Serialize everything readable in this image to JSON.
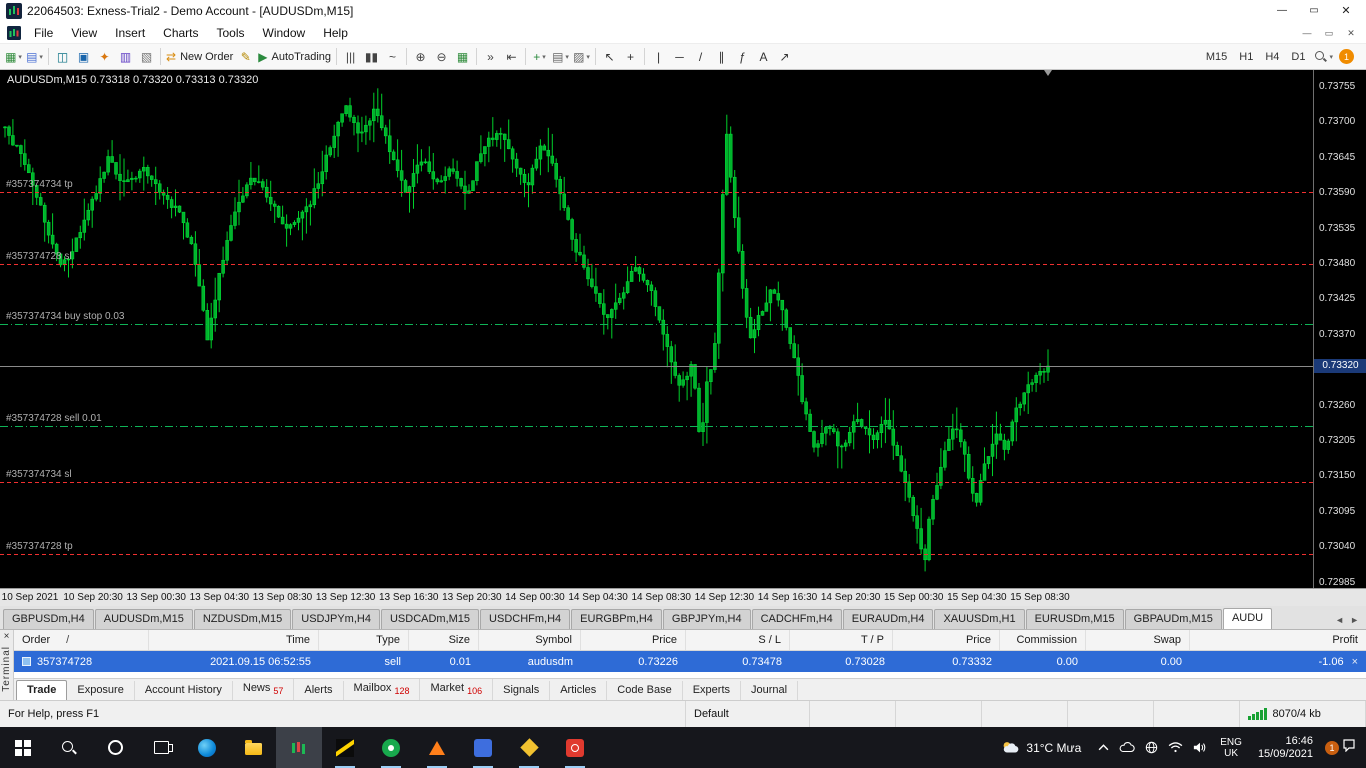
{
  "window": {
    "title": "22064503: Exness-Trial2 - Demo Account - [AUDUSDm,M15]",
    "controls": {
      "minimize": "—",
      "restore": "▭",
      "close": "✕"
    }
  },
  "menu": {
    "items": [
      "File",
      "View",
      "Insert",
      "Charts",
      "Tools",
      "Window",
      "Help"
    ]
  },
  "toolbar": {
    "caret_glyph": "▾",
    "notification_count": "1",
    "timeframes": [
      "M15",
      "H1",
      "H4",
      "D1"
    ],
    "groups": [
      {
        "items": [
          {
            "name": "new-chart",
            "glyph": "▦",
            "color": "#2e8b3a",
            "caret": true
          },
          {
            "name": "profiles",
            "glyph": "▤",
            "color": "#4a6fd4",
            "caret": true
          }
        ]
      },
      {
        "items": [
          {
            "name": "market-watch",
            "glyph": "◫",
            "color": "#0b7285"
          },
          {
            "name": "data-window",
            "glyph": "▣",
            "color": "#1864ab"
          },
          {
            "name": "navigator",
            "glyph": "✦",
            "color": "#d9770f"
          },
          {
            "name": "terminal-panel",
            "glyph": "▥",
            "color": "#5f3dc4"
          },
          {
            "name": "strategy-tester",
            "glyph": "▧",
            "color": "#767676"
          }
        ]
      },
      {
        "items": [
          {
            "name": "new-order",
            "glyph": "⇄",
            "color": "#d98b0f",
            "label": "New Order"
          },
          {
            "name": "metaeditor",
            "glyph": "✎",
            "color": "#b58900"
          },
          {
            "name": "autotrading",
            "glyph": "▶",
            "color": "#2b8a3e",
            "label": "AutoTrading"
          }
        ]
      },
      {
        "items": [
          {
            "name": "bar-chart-mode",
            "glyph": "|||",
            "color": "#444444"
          },
          {
            "name": "candlestick-mode",
            "glyph": "▮▮",
            "color": "#444444"
          },
          {
            "name": "line-chart-mode",
            "glyph": "~",
            "color": "#444444"
          }
        ]
      },
      {
        "items": [
          {
            "name": "zoom-in",
            "glyph": "⊕",
            "color": "#444444"
          },
          {
            "name": "zoom-out",
            "glyph": "⊖",
            "color": "#444444"
          },
          {
            "name": "tile-windows",
            "glyph": "▦",
            "color": "#2e8b3a"
          }
        ]
      },
      {
        "items": [
          {
            "name": "auto-scroll",
            "glyph": "»",
            "color": "#444444"
          },
          {
            "name": "chart-shift",
            "glyph": "⇤",
            "color": "#444444"
          }
        ]
      },
      {
        "items": [
          {
            "name": "indicators",
            "glyph": "+",
            "color": "#2b8a3e",
            "caret": true
          },
          {
            "name": "periods",
            "glyph": "▤",
            "color": "#666666",
            "caret": true
          },
          {
            "name": "templates",
            "glyph": "▨",
            "color": "#666666",
            "caret": true
          }
        ]
      },
      {
        "items": [
          {
            "name": "cursor",
            "glyph": "↖",
            "color": "#333333"
          },
          {
            "name": "crosshair",
            "glyph": "+",
            "color": "#333333"
          }
        ]
      },
      {
        "items": [
          {
            "name": "vertical-line",
            "glyph": "|",
            "color": "#333333"
          },
          {
            "name": "horizontal-line",
            "glyph": "─",
            "color": "#333333"
          },
          {
            "name": "trendline",
            "glyph": "/",
            "color": "#333333"
          },
          {
            "name": "equidistant-channel",
            "glyph": "∥",
            "color": "#333333"
          },
          {
            "name": "fibonacci",
            "glyph": "ƒ",
            "color": "#333333"
          },
          {
            "name": "text-label",
            "glyph": "A",
            "color": "#333333"
          },
          {
            "name": "arrows-tool",
            "glyph": "↗",
            "color": "#333333"
          }
        ]
      }
    ]
  },
  "chart": {
    "symbol_ohlc": "AUDUSDm,M15 0.73318 0.73320 0.73313 0.73320",
    "price_axis": {
      "min": 0.72975,
      "max": 0.7378,
      "labels": [
        "0.73755",
        "0.73700",
        "0.73645",
        "0.73590",
        "0.73535",
        "0.73480",
        "0.73425",
        "0.73370",
        "0.73260",
        "0.73205",
        "0.73150",
        "0.73095",
        "0.73040",
        "0.72985"
      ],
      "current": "0.73320"
    },
    "time_axis": [
      "10 Sep 2021",
      "10 Sep 20:30",
      "13 Sep 00:30",
      "13 Sep 04:30",
      "13 Sep 08:30",
      "13 Sep 12:30",
      "13 Sep 16:30",
      "13 Sep 20:30",
      "14 Sep 00:30",
      "14 Sep 04:30",
      "14 Sep 08:30",
      "14 Sep 12:30",
      "14 Sep 16:30",
      "14 Sep 20:30",
      "15 Sep 00:30",
      "15 Sep 04:30",
      "15 Sep 08:30"
    ],
    "levels": [
      {
        "label": "#357374734 tp",
        "price": 0.7359,
        "color": "#f03030",
        "style": "dashed"
      },
      {
        "label": "#357374728 sl",
        "price": 0.73478,
        "color": "#f03030",
        "style": "dashed"
      },
      {
        "label": "#357374734 buy stop 0.03",
        "price": 0.73386,
        "color": "#0fb357",
        "style": "dashdot"
      },
      {
        "label": "#357374728 sell 0.01",
        "price": 0.73226,
        "color": "#0fb357",
        "style": "dashdot"
      },
      {
        "label": "#357374734 sl",
        "price": 0.7314,
        "color": "#f03030",
        "style": "dashed"
      },
      {
        "label": "#357374728 tp",
        "price": 0.73028,
        "color": "#f03030",
        "style": "dashed"
      }
    ],
    "chart_data": {
      "type": "candlestick",
      "symbol": "AUDUSDm",
      "timeframe": "M15",
      "ohlc_display": {
        "open": "0.73318",
        "high": "0.73320",
        "low": "0.73313",
        "close": "0.73320"
      },
      "last_close": 0.7332,
      "candle_count": 264,
      "price_range": [
        0.72975,
        0.7378
      ],
      "visible_span": "10 Sep 2021 00:00 - 15 Sep 2021 08:30",
      "path_waypoints": [
        [
          5,
          0.7369
        ],
        [
          18,
          0.73655
        ],
        [
          32,
          0.7361
        ],
        [
          48,
          0.7353
        ],
        [
          60,
          0.73472
        ],
        [
          72,
          0.735
        ],
        [
          88,
          0.73555
        ],
        [
          108,
          0.7364
        ],
        [
          125,
          0.736
        ],
        [
          145,
          0.73625
        ],
        [
          165,
          0.7358
        ],
        [
          182,
          0.73555
        ],
        [
          196,
          0.7348
        ],
        [
          207,
          0.7336
        ],
        [
          218,
          0.7345
        ],
        [
          232,
          0.7355
        ],
        [
          252,
          0.73615
        ],
        [
          268,
          0.7358
        ],
        [
          288,
          0.7353
        ],
        [
          308,
          0.73565
        ],
        [
          328,
          0.7365
        ],
        [
          345,
          0.73725
        ],
        [
          360,
          0.7368
        ],
        [
          375,
          0.7372
        ],
        [
          392,
          0.73645
        ],
        [
          407,
          0.7359
        ],
        [
          422,
          0.73645
        ],
        [
          437,
          0.736
        ],
        [
          452,
          0.73625
        ],
        [
          467,
          0.7358
        ],
        [
          482,
          0.7366
        ],
        [
          500,
          0.7369
        ],
        [
          512,
          0.7364
        ],
        [
          528,
          0.736
        ],
        [
          540,
          0.73665
        ],
        [
          552,
          0.7364
        ],
        [
          558,
          0.736
        ],
        [
          574,
          0.7351
        ],
        [
          590,
          0.7345
        ],
        [
          605,
          0.7339
        ],
        [
          620,
          0.73425
        ],
        [
          636,
          0.73475
        ],
        [
          652,
          0.7343
        ],
        [
          666,
          0.7335
        ],
        [
          680,
          0.73285
        ],
        [
          692,
          0.73325
        ],
        [
          701,
          0.73195
        ],
        [
          707,
          0.7329
        ],
        [
          714,
          0.7333
        ],
        [
          720,
          0.735
        ],
        [
          726,
          0.7369
        ],
        [
          733,
          0.7358
        ],
        [
          741,
          0.7346
        ],
        [
          750,
          0.7336
        ],
        [
          760,
          0.734
        ],
        [
          772,
          0.73445
        ],
        [
          783,
          0.734
        ],
        [
          794,
          0.7333
        ],
        [
          804,
          0.73255
        ],
        [
          815,
          0.73185
        ],
        [
          828,
          0.7323
        ],
        [
          842,
          0.7319
        ],
        [
          857,
          0.7324
        ],
        [
          872,
          0.73205
        ],
        [
          886,
          0.7324
        ],
        [
          899,
          0.73165
        ],
        [
          910,
          0.7311
        ],
        [
          921,
          0.7304
        ],
        [
          924,
          0.73005
        ],
        [
          928,
          0.7308
        ],
        [
          943,
          0.73175
        ],
        [
          954,
          0.7323
        ],
        [
          965,
          0.73175
        ],
        [
          975,
          0.731
        ],
        [
          985,
          0.73165
        ],
        [
          995,
          0.73215
        ],
        [
          1005,
          0.73185
        ],
        [
          1015,
          0.73245
        ],
        [
          1026,
          0.73285
        ],
        [
          1037,
          0.73305
        ],
        [
          1048,
          0.7332
        ]
      ]
    }
  },
  "chart_tabs": {
    "scroll_left": "◄",
    "scroll_right": "►",
    "tabs": [
      {
        "label": "GBPUSDm,H4"
      },
      {
        "label": "AUDUSDm,M15"
      },
      {
        "label": "NZDUSDm,M15"
      },
      {
        "label": "USDJPYm,H4"
      },
      {
        "label": "USDCADm,M15"
      },
      {
        "label": "USDCHFm,H4"
      },
      {
        "label": "EURGBPm,H4"
      },
      {
        "label": "GBPJPYm,H4"
      },
      {
        "label": "CADCHFm,H4"
      },
      {
        "label": "EURAUDm,H4"
      },
      {
        "label": "XAUUSDm,H1"
      },
      {
        "label": "EURUSDm,M15"
      },
      {
        "label": "GBPAUDm,M15"
      },
      {
        "label": "AUDU",
        "active": true
      }
    ]
  },
  "terminal": {
    "close_glyph": "×",
    "vertical_label": "Terminal",
    "columns": [
      {
        "label": "Order",
        "sort": "/"
      },
      {
        "label": "Time"
      },
      {
        "label": "Type"
      },
      {
        "label": "Size"
      },
      {
        "label": "Symbol"
      },
      {
        "label": "Price"
      },
      {
        "label": "S / L"
      },
      {
        "label": "T / P"
      },
      {
        "label": "Price"
      },
      {
        "label": "Commission"
      },
      {
        "label": "Swap"
      },
      {
        "label": "Profit"
      }
    ],
    "orders": [
      {
        "order": "357374728",
        "time": "2021.09.15 06:52:55",
        "type": "sell",
        "size": "0.01",
        "symbol": "audusdm",
        "price": "0.73226",
        "sl": "0.73478",
        "tp": "0.73028",
        "price_current": "0.73332",
        "commission": "0.00",
        "swap": "0.00",
        "profit": "-1.06"
      }
    ],
    "tabs": [
      {
        "label": "Trade"
      },
      {
        "label": "Exposure"
      },
      {
        "label": "Account History"
      },
      {
        "label": "News",
        "badge": "57"
      },
      {
        "label": "Alerts"
      },
      {
        "label": "Mailbox",
        "badge": "128"
      },
      {
        "label": "Market",
        "badge": "106"
      },
      {
        "label": "Signals"
      },
      {
        "label": "Articles"
      },
      {
        "label": "Code Base"
      },
      {
        "label": "Experts"
      },
      {
        "label": "Journal"
      }
    ],
    "active_tab": "Trade"
  },
  "status_bar": {
    "help": "For Help, press F1",
    "profile": "Default",
    "connection": "8070/4 kb"
  },
  "taskbar": {
    "apps": [
      {
        "name": "start"
      },
      {
        "name": "search"
      },
      {
        "name": "cortana"
      },
      {
        "name": "task-view"
      },
      {
        "name": "edge"
      },
      {
        "name": "file-explorer"
      },
      {
        "name": "mt4",
        "highlight": true
      },
      {
        "name": "exness",
        "indicator": true
      },
      {
        "name": "green-app",
        "indicator": true
      },
      {
        "name": "vlc",
        "indicator": true
      },
      {
        "name": "blue-app",
        "indicator": true
      },
      {
        "name": "yellow-app",
        "indicator": true
      },
      {
        "name": "red-app",
        "indicator": true
      }
    ],
    "weather": "31°C Mưa",
    "language_line1": "ENG",
    "language_line2": "UK",
    "time": "16:46",
    "date": "15/09/2021",
    "notification_count": "1"
  }
}
